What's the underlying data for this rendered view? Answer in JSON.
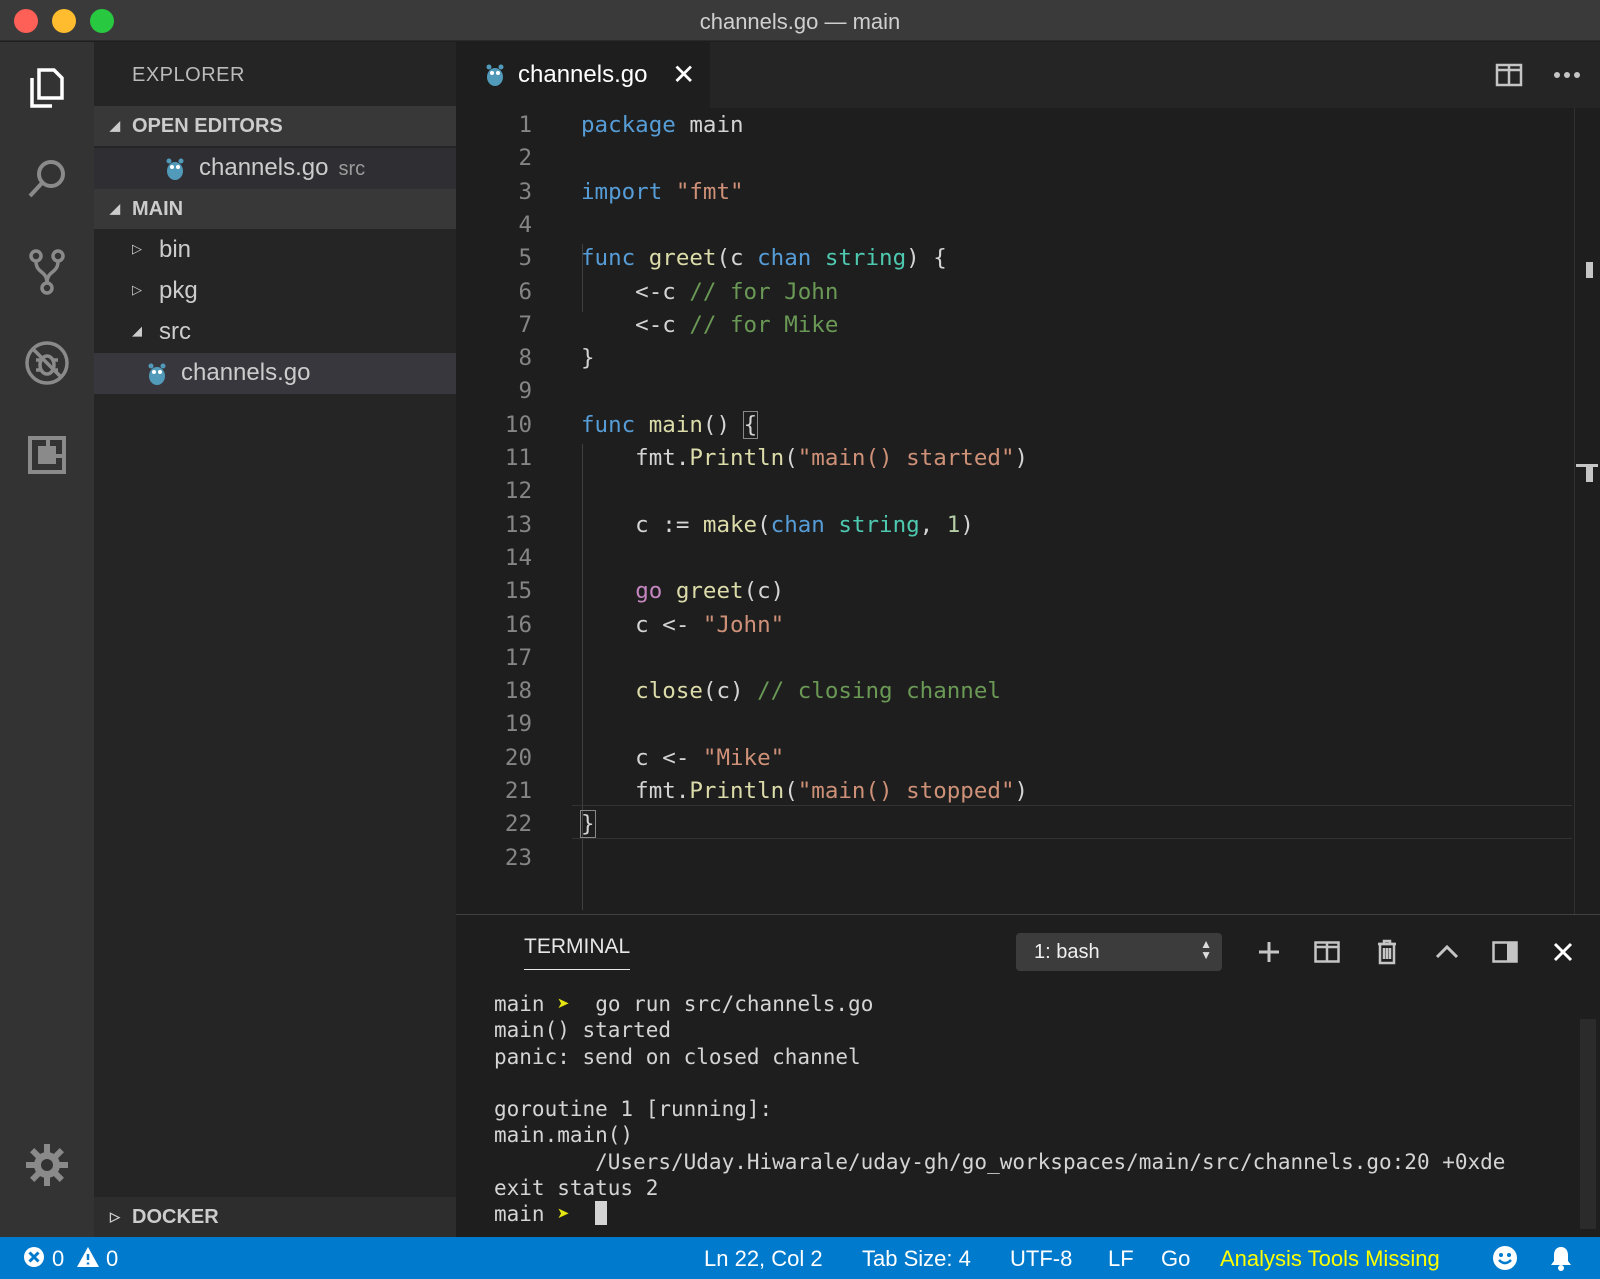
{
  "window": {
    "title": "channels.go — main"
  },
  "activity_bar": {
    "items": [
      "explorer",
      "search",
      "source-control",
      "debug",
      "extensions"
    ],
    "bottom": "manage"
  },
  "sidebar": {
    "title": "EXPLORER",
    "open_editors": {
      "label": "OPEN EDITORS",
      "items": [
        {
          "name": "channels.go",
          "description": "src"
        }
      ]
    },
    "folder": {
      "label": "MAIN",
      "items": [
        {
          "name": "bin",
          "expanded": false
        },
        {
          "name": "pkg",
          "expanded": false
        },
        {
          "name": "src",
          "expanded": true
        },
        {
          "name": "channels.go"
        }
      ]
    },
    "docker": {
      "label": "DOCKER"
    }
  },
  "tabs": [
    {
      "label": "channels.go",
      "active": true,
      "close": "✕"
    }
  ],
  "editor": {
    "lines": [
      "package main",
      "",
      "import \"fmt\"",
      "",
      "func greet(c chan string) {",
      "\t<-c // for John",
      "\t<-c // for Mike",
      "}",
      "",
      "func main() {",
      "\tfmt.Println(\"main() started\")",
      "",
      "\tc := make(chan string, 1)",
      "",
      "\tgo greet(c)",
      "\tc <- \"John\"",
      "",
      "\tclose(c) // closing channel",
      "",
      "\tc <- \"Mike\"",
      "\tfmt.Println(\"main() stopped\")",
      "}",
      ""
    ],
    "current_line": 22
  },
  "panel": {
    "tab": "TERMINAL",
    "terminal_select": "1: bash",
    "terminal": {
      "prompt_dir": "main",
      "prompt_symbol": "➤",
      "command": "go run src/channels.go",
      "output": [
        "main() started",
        "panic: send on closed channel",
        "",
        "goroutine 1 [running]:",
        "main.main()",
        "        /Users/Uday.Hiwarale/uday-gh/go_workspaces/main/src/channels.go:20 +0xde",
        "exit status 2"
      ]
    }
  },
  "status_bar": {
    "errors": "0",
    "warnings": "0",
    "position": "Ln 22, Col 2",
    "tab_size": "Tab Size: 4",
    "encoding": "UTF-8",
    "eol": "LF",
    "language": "Go",
    "analysis": "Analysis Tools Missing"
  },
  "colors": {
    "status_bar": "#007acc",
    "keyword": "#569cd6",
    "string": "#ce9178",
    "comment": "#6a9955",
    "function": "#dcdcaa",
    "type": "#4ec9b0",
    "analysis_warning": "#ffff00"
  }
}
